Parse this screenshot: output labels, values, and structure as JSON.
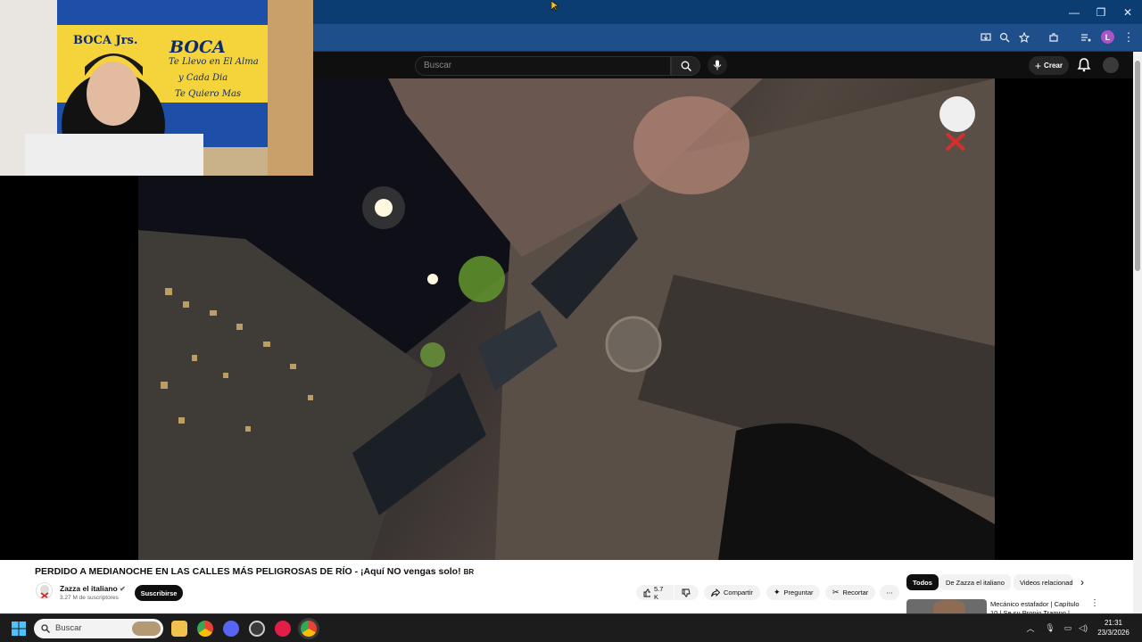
{
  "browser": {
    "window_controls": {
      "minimize": "—",
      "restore": "❐",
      "close": "✕"
    }
  },
  "youtube": {
    "search_placeholder": "Buscar",
    "create_label": "Crear"
  },
  "webcam_flag": {
    "line1": "BOCA Jrs.",
    "line2": "BOCA",
    "line3": "Te Llevo en El Alma",
    "line4": "y Cada Dia",
    "line5": "Te Quiero Mas"
  },
  "video": {
    "title": "PERDIDO A MEDIANOCHE EN LAS CALLES MÁS PELIGROSAS DE RÍO - ¡Aquí NO vengas solo!",
    "title_badge": "BR",
    "channel_name": "Zazza el italiano",
    "subscribers": "3.27 M de suscriptores",
    "subscribe_label": "Suscribirse",
    "likes": "5.7 K",
    "share_label": "Compartir",
    "ask_label": "Preguntar",
    "clip_label": "Recortar",
    "more_label": "⋯"
  },
  "related": {
    "chips": [
      "Todos",
      "De Zazza el italiano",
      "Videos relacionados"
    ],
    "first_video_title": "Mecánico estafador | Capítulo 10 | Se su Propio Trampo |"
  },
  "taskbar": {
    "search_placeholder": "Buscar",
    "time": "21:31",
    "date": "23/3/2026"
  }
}
